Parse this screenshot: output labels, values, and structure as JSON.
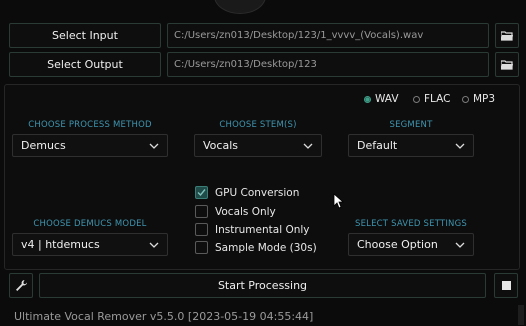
{
  "io": {
    "select_input_label": "Select Input",
    "select_output_label": "Select Output",
    "input_path": "C:/Users/zn013/Desktop/123/1_vvvv_(Vocals).wav",
    "output_path": "C:/Users/zn013/Desktop/123"
  },
  "format": {
    "options": [
      "WAV",
      "FLAC",
      "MP3"
    ],
    "selected": "WAV"
  },
  "settings": {
    "process_method_label": "CHOOSE PROCESS METHOD",
    "process_method_value": "Demucs",
    "stems_label": "CHOOSE STEM(S)",
    "stems_value": "Vocals",
    "segment_label": "SEGMENT",
    "segment_value": "Default",
    "model_label": "CHOOSE DEMUCS MODEL",
    "model_value": "v4 | htdemucs",
    "saved_settings_label": "SELECT SAVED SETTINGS",
    "saved_settings_value": "Choose Option"
  },
  "options": [
    {
      "label": "GPU Conversion",
      "checked": true
    },
    {
      "label": "Vocals Only",
      "checked": false
    },
    {
      "label": "Instrumental Only",
      "checked": false
    },
    {
      "label": "Sample Mode (30s)",
      "checked": false
    }
  ],
  "actions": {
    "start_label": "Start Processing"
  },
  "status_text": "Ultimate Vocal Remover v5.5.0 [2023-05-19 04:55:44]",
  "colors": {
    "accent": "#3f95b0",
    "checkbox_checked": "#1f4b49",
    "background": "#0b0b0b"
  }
}
